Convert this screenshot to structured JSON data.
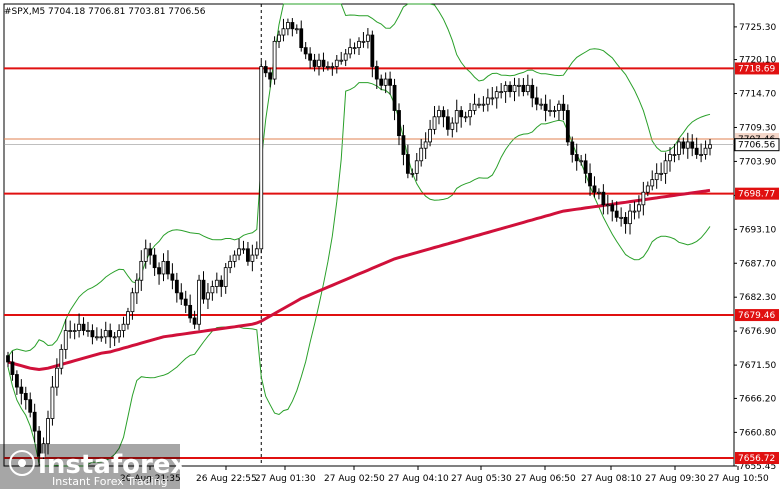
{
  "chart_data": {
    "type": "candlestick",
    "title": "#SPX,M5  7704.18 7706.81 7703.81 7706.56",
    "ylim": [
      7655.45,
      7728.94
    ],
    "y_ticks": [
      "7725.30",
      "7720.10",
      "7714.70",
      "7709.30",
      "7703.90",
      "7698.50",
      "7693.10",
      "7687.70",
      "7682.30",
      "7676.90",
      "7671.50",
      "7666.20",
      "7660.80",
      "7655.45"
    ],
    "x_ticks": [
      "26 Aug 21:35",
      "26 Aug 22:55",
      "27 Aug 01:30",
      "27 Aug 02:50",
      "27 Aug 04:10",
      "27 Aug 05:30",
      "27 Aug 06:50",
      "27 Aug 08:10",
      "27 Aug 09:30",
      "27 Aug 10:50"
    ],
    "horizontal_levels": [
      {
        "value": 7718.69,
        "label": "7718.69",
        "color": "#e01010"
      },
      {
        "value": 7698.77,
        "label": "7698.77",
        "color": "#e01010"
      },
      {
        "value": 7679.46,
        "label": "7679.46",
        "color": "#e01010"
      },
      {
        "value": 7656.72,
        "label": "7656.72",
        "color": "#e01010"
      }
    ],
    "current_price": {
      "value": 7706.56,
      "label": "7706.56"
    },
    "ask_line": {
      "value": 7707.46,
      "label": "7707.46",
      "color": "#e08050"
    },
    "session_separator_index": 57,
    "closes": [
      7672,
      7670,
      7668,
      7667,
      7666,
      7664,
      7661,
      7657,
      7659,
      7663,
      7668,
      7671,
      7674,
      7677,
      7677,
      7677,
      7678,
      7677,
      7677,
      7676,
      7676,
      7676,
      7677,
      7676,
      7676,
      7677,
      7678,
      7680,
      7683,
      7685,
      7688,
      7690,
      7689,
      7687,
      7686,
      7688,
      7686,
      7685,
      7683,
      7682,
      7681,
      7679,
      7678,
      7685,
      7682,
      7683,
      7684,
      7685,
      7684,
      7687,
      7688,
      7689,
      7690,
      7690,
      7688,
      7689,
      7690,
      7719,
      7718,
      7717,
      7723,
      7724,
      7725,
      7726,
      7725,
      7725,
      7722,
      7721,
      7720,
      7719,
      7720,
      7719,
      7719,
      7719,
      7720,
      7720,
      7721,
      7722,
      7722,
      7723,
      7723,
      7724,
      7719,
      7717,
      7716,
      7717,
      7716,
      7712,
      7708,
      7705,
      7702,
      7702,
      7704,
      7706,
      7707,
      7709,
      7711,
      7712,
      7711,
      7709,
      7710,
      7712,
      7711,
      7711,
      7712,
      7713,
      7713,
      7713,
      7714,
      7714,
      7715,
      7715,
      7716,
      7715,
      7716,
      7716,
      7715,
      7716,
      7714,
      7713,
      7713,
      7712,
      7712,
      7712,
      7713,
      7712,
      7707,
      7705,
      7704,
      7704,
      7702,
      7700,
      7699,
      7699,
      7697,
      7697,
      7696,
      7695,
      7695,
      7694,
      7696,
      7696,
      7697,
      7699,
      7700,
      7701,
      7702,
      7702,
      7704,
      7705,
      7705,
      7707,
      7706,
      7707,
      7706,
      7705,
      7705,
      7706,
      7706.56
    ],
    "ma_red": [
      7672,
      7671.8,
      7671.6,
      7671.4,
      7671.2,
      7671,
      7670.9,
      7670.8,
      7670.9,
      7671,
      7671.2,
      7671.4,
      7671.6,
      7671.8,
      7672,
      7672.2,
      7672.4,
      7672.6,
      7672.8,
      7673,
      7673.2,
      7673.4,
      7673.5,
      7673.6,
      7673.8,
      7674,
      7674.2,
      7674.4,
      7674.6,
      7674.8,
      7675,
      7675.2,
      7675.4,
      7675.6,
      7675.8,
      7676,
      7676.1,
      7676.2,
      7676.3,
      7676.4,
      7676.5,
      7676.6,
      7676.7,
      7676.8,
      7676.9,
      7677,
      7677.1,
      7677.2,
      7677.3,
      7677.4,
      7677.5,
      7677.6,
      7677.7,
      7677.8,
      7677.9,
      7678,
      7678.2,
      7678.5,
      7678.9,
      7679.3,
      7679.7,
      7680.1,
      7680.5,
      7680.9,
      7681.3,
      7681.7,
      7682.1,
      7682.4,
      7682.7,
      7683,
      7683.3,
      7683.6,
      7683.9,
      7684.2,
      7684.5,
      7684.8,
      7685.1,
      7685.4,
      7685.7,
      7686,
      7686.3,
      7686.6,
      7686.9,
      7687.2,
      7687.5,
      7687.8,
      7688.1,
      7688.4,
      7688.6,
      7688.8,
      7689,
      7689.2,
      7689.4,
      7689.6,
      7689.8,
      7690,
      7690.2,
      7690.4,
      7690.6,
      7690.8,
      7691,
      7691.2,
      7691.4,
      7691.6,
      7691.8,
      7692,
      7692.2,
      7692.4,
      7692.6,
      7692.8,
      7693,
      7693.2,
      7693.4,
      7693.6,
      7693.8,
      7694,
      7694.2,
      7694.4,
      7694.6,
      7694.8,
      7695,
      7695.2,
      7695.4,
      7695.6,
      7695.8,
      7696,
      7696.1,
      7696.2,
      7696.3,
      7696.4,
      7696.5,
      7696.6,
      7696.7,
      7696.8,
      7696.9,
      7697,
      7697.1,
      7697.2,
      7697.3,
      7697.4,
      7697.5,
      7697.6,
      7697.7,
      7697.8,
      7697.9,
      7698,
      7698.1,
      7698.2,
      7698.3,
      7698.4,
      7698.5,
      7698.6,
      7698.7,
      7698.8,
      7698.9,
      7699,
      7699.1,
      7699.2,
      7699.3
    ]
  },
  "logo": {
    "name": "instaforex",
    "tagline": "Instant Forex Trading"
  },
  "colors": {
    "background": "#ffffff",
    "candle": "#000000",
    "ma": "#d0103a",
    "bands": "#2aa02a",
    "level": "#e01010",
    "separator": "#000000"
  }
}
